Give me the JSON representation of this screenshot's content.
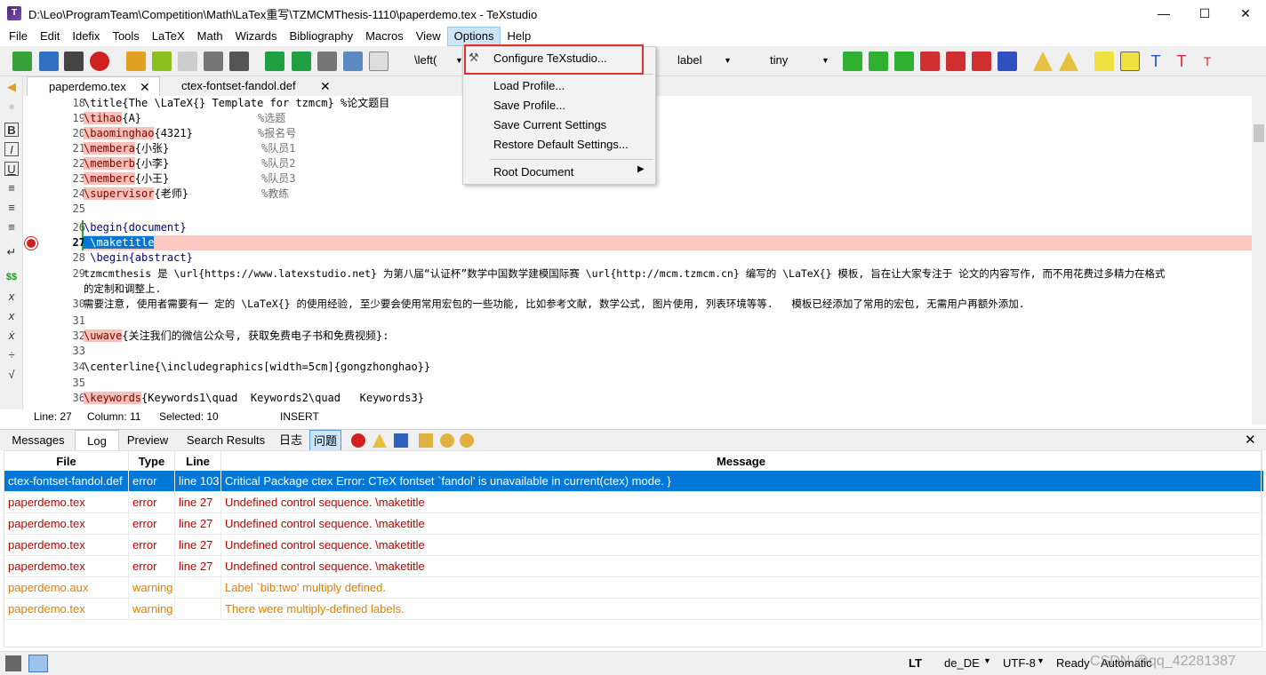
{
  "window": {
    "title": "D:\\Leo\\ProgramTeam\\Competition\\Math\\LaTex重写\\TZMCMThesis-1110\\paperdemo.tex - TeXstudio",
    "minimize": "—",
    "maximize": "☐",
    "close": "✕"
  },
  "menu": {
    "items": [
      "File",
      "Edit",
      "Idefix",
      "Tools",
      "LaTeX",
      "Math",
      "Wizards",
      "Bibliography",
      "Macros",
      "View",
      "Options",
      "Help"
    ]
  },
  "toolbar": {
    "left_combo": "\\left(",
    "label_combo": "label",
    "size_combo": "tiny"
  },
  "tabs": [
    {
      "label": "paperdemo.tex"
    },
    {
      "label": "ctex-fontset-fandol.def"
    }
  ],
  "editor": {
    "lines": [
      {
        "num": "18",
        "text": "\\title{The \\LaTeX{} Template for tzmcm} %论文题目"
      },
      {
        "num": "19",
        "cmd": "\\tihao",
        "rest": "{A}",
        "comment": "%选题"
      },
      {
        "num": "20",
        "cmd": "\\baominghao",
        "rest": "{4321}",
        "comment": "%报名号"
      },
      {
        "num": "21",
        "cmd": "\\membera",
        "rest": "{小张}",
        "comment": "%队员1"
      },
      {
        "num": "22",
        "cmd": "\\memberb",
        "rest": "{小李}",
        "comment": "%队员2"
      },
      {
        "num": "23",
        "cmd": "\\memberc",
        "rest": "{小王}",
        "comment": "%队员3"
      },
      {
        "num": "24",
        "cmd": "\\supervisor",
        "rest": "{老师}",
        "comment": "%教练"
      },
      {
        "num": "25",
        "text": ""
      },
      {
        "num": "26",
        "text": "\\begin{document}"
      },
      {
        "num": "27",
        "text": " \\maketitle"
      },
      {
        "num": "28",
        "text": " \\begin{abstract}"
      },
      {
        "num": "29",
        "text": "tzmcmthesis 是 \\url{https://www.latexstudio.net} 为第八届“认证杯”数学中国数学建模国际赛 \\url{http://mcm.tzmcm.cn} 编写的 \\LaTeX{} 模板, 旨在让大家专注于 论文的内容写作, 而不用花费过多精力在格式"
      },
      {
        "num": "",
        "text": "的定制和调整上."
      },
      {
        "num": "30",
        "text": "需要注意, 使用者需要有一 定的 \\LaTeX{} 的使用经验, 至少要会使用常用宏包的一些功能, 比如参考文献, 数学公式, 图片使用, 列表环境等等.   模板已经添加了常用的宏包, 无需用户再额外添加."
      },
      {
        "num": "31",
        "text": ""
      },
      {
        "num": "32",
        "cmd": "\\uwave",
        "rest": "{关注我们的微信公众号, 获取免费电子书和免费视频}:"
      },
      {
        "num": "33",
        "text": ""
      },
      {
        "num": "34",
        "text": "\\centerline{\\includegraphics[width=5cm]{gongzhonghao}}"
      },
      {
        "num": "35",
        "text": ""
      },
      {
        "num": "36",
        "cmd": "\\keywords",
        "rest": "{Keywords1\\quad  Keywords2\\quad   Keywords3}"
      }
    ]
  },
  "status": {
    "line": "Line: 27",
    "column": "Column: 11",
    "selected": "Selected: 10",
    "mode": "INSERT"
  },
  "panel": {
    "tabs": [
      "Messages",
      "Log",
      "Preview",
      "Search Results",
      "日志",
      "问题"
    ],
    "close": "✕",
    "headers": [
      "File",
      "Type",
      "Line",
      "Message"
    ],
    "rows": [
      {
        "file": "ctex-fontset-fandol.def",
        "type": "error",
        "line": "line 103",
        "message": "Critical Package ctex Error: CTeX fontset `fandol' is unavailable in current(ctex) mode. }",
        "kind": "sel"
      },
      {
        "file": "paperdemo.tex",
        "type": "error",
        "line": "line 27",
        "message": "Undefined control sequence. \\maketitle",
        "kind": "err"
      },
      {
        "file": "paperdemo.tex",
        "type": "error",
        "line": "line 27",
        "message": "Undefined control sequence. \\maketitle",
        "kind": "err"
      },
      {
        "file": "paperdemo.tex",
        "type": "error",
        "line": "line 27",
        "message": "Undefined control sequence. \\maketitle",
        "kind": "err"
      },
      {
        "file": "paperdemo.tex",
        "type": "error",
        "line": "line 27",
        "message": "Undefined control sequence. \\maketitle",
        "kind": "err"
      },
      {
        "file": "paperdemo.aux",
        "type": "warning",
        "line": "",
        "message": "Label `bib:two' multiply defined.",
        "kind": "warn"
      },
      {
        "file": "paperdemo.tex",
        "type": "warning",
        "line": "",
        "message": "There were multiply-defined labels.",
        "kind": "warn"
      }
    ]
  },
  "bottom": {
    "lt": "LT",
    "lang": "de_DE",
    "encoding": "UTF-8",
    "ready": "Ready",
    "automatic": "Automatic",
    "watermark": "CSDN @qq_42281387"
  },
  "dropdown": {
    "items": [
      "Configure TeXstudio...",
      "Load Profile...",
      "Save Profile...",
      "Save Current Settings",
      "Restore Default Settings...",
      "Root Document"
    ]
  }
}
